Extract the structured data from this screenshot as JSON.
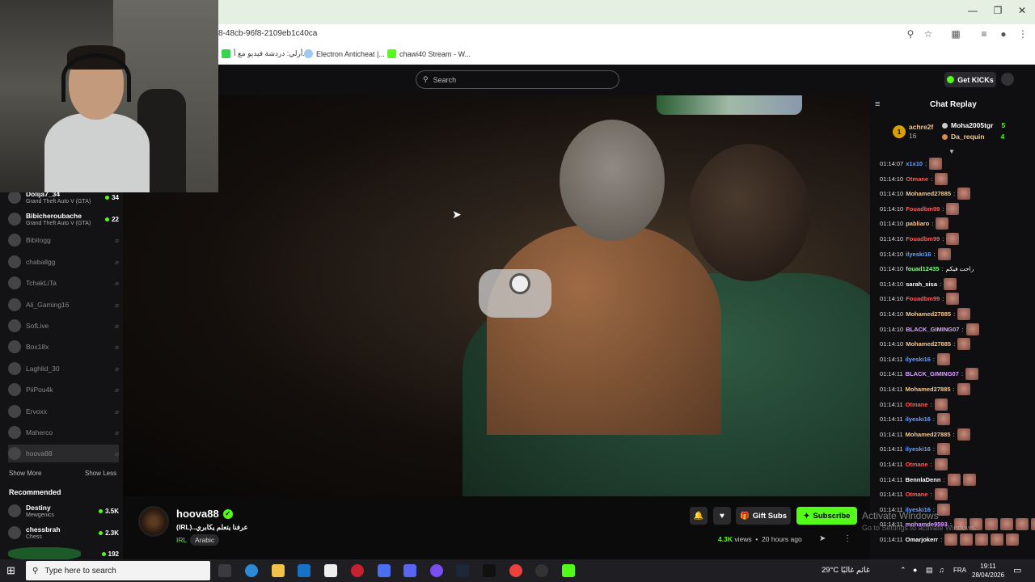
{
  "browser": {
    "url": "8-48cb-96f8-2109eb1c40ca",
    "bookmarks": [
      "أرلي: دردشة فيديو مع أ...",
      "Electron Anticheat |...",
      "chawi40 Stream - W..."
    ]
  },
  "topnav": {
    "search_placeholder": "Search",
    "get_kicks": "Get KICKs"
  },
  "sidebar": {
    "following": [
      {
        "name": "Dolija7_34",
        "game": "Grand Theft Auto V (GTA)",
        "viewers": "34",
        "live": true
      },
      {
        "name": "Bibicheroubache",
        "game": "Grand Theft Auto V (GTA)",
        "viewers": "22",
        "live": true
      },
      {
        "name": "Bibitogg",
        "live": false
      },
      {
        "name": "chaballgg",
        "live": false
      },
      {
        "name": "TchakLiTa",
        "live": false
      },
      {
        "name": "Ali_Gaming16",
        "live": false
      },
      {
        "name": "SofLive",
        "live": false
      },
      {
        "name": "Box18x",
        "live": false
      },
      {
        "name": "Laghlid_30",
        "live": false
      },
      {
        "name": "PiiPou4k",
        "live": false
      },
      {
        "name": "Ervoxx",
        "live": false
      },
      {
        "name": "Maherco",
        "live": false
      },
      {
        "name": "hoova88",
        "live": false
      }
    ],
    "show_more": "Show More",
    "show_less": "Show Less",
    "recommended_label": "Recommended",
    "recommended": [
      {
        "name": "Destiny",
        "game": "Mewgenics",
        "viewers": "3.5K"
      },
      {
        "name": "chessbrah",
        "game": "Chess",
        "viewers": "2.3K"
      },
      {
        "name": "",
        "game": "",
        "viewers": "192"
      }
    ]
  },
  "stream": {
    "streamer": "hoova88",
    "title": "(IRL)..عرفنا يتعلم يكابري",
    "category": "IRL",
    "tag": "Arabic",
    "gift_subs": "Gift Subs",
    "subscribe": "Subscribe",
    "views_count": "4.3K",
    "views_label": "views",
    "time_ago": "20 hours ago"
  },
  "chat": {
    "title": "Chat Replay",
    "gifters": [
      {
        "name": "achre2f",
        "count": "16",
        "rank": "1"
      },
      {
        "name": "Moha2005tgr",
        "count": "5"
      },
      {
        "name": "Da_requin",
        "count": "4"
      }
    ],
    "messages": [
      {
        "ts": "01:14:07",
        "user": "x1x10",
        "color": "#6aa0ff",
        "text": "",
        "emotes": 1
      },
      {
        "ts": "01:14:10",
        "user": "Otmane",
        "color": "#ff5a5a",
        "text": "",
        "emotes": 1
      },
      {
        "ts": "01:14:10",
        "user": "Mohamed27885",
        "color": "#f5c890",
        "text": "",
        "emotes": 1
      },
      {
        "ts": "01:14:10",
        "user": "Fouadbm99",
        "color": "#ff5a5a",
        "text": "",
        "emotes": 1
      },
      {
        "ts": "01:14:10",
        "user": "pabliaro",
        "color": "#f5c890",
        "text": "",
        "emotes": 1
      },
      {
        "ts": "01:14:10",
        "user": "Fouadbm99",
        "color": "#ff5a5a",
        "text": "",
        "emotes": 1
      },
      {
        "ts": "01:14:10",
        "user": "ilyeski16",
        "color": "#6aa0ff",
        "text": "",
        "emotes": 1
      },
      {
        "ts": "01:14:10",
        "user": "fouad12435",
        "color": "#7dff7d",
        "text": "راحت فيكم",
        "emotes": 0
      },
      {
        "ts": "01:14:10",
        "user": "sarah_sisa",
        "color": "#ffffff",
        "text": "",
        "emotes": 1
      },
      {
        "ts": "01:14:10",
        "user": "Fouadbm99",
        "color": "#ff5a5a",
        "text": "",
        "emotes": 1
      },
      {
        "ts": "01:14:10",
        "user": "Mohamed27885",
        "color": "#f5c890",
        "text": "",
        "emotes": 1
      },
      {
        "ts": "01:14:10",
        "user": "BLACK_GIMING07",
        "color": "#d9a0ff",
        "text": "",
        "emotes": 1
      },
      {
        "ts": "01:14:10",
        "user": "Mohamed27885",
        "color": "#f5c890",
        "text": "",
        "emotes": 1
      },
      {
        "ts": "01:14:11",
        "user": "ilyeski16",
        "color": "#6aa0ff",
        "text": "",
        "emotes": 1
      },
      {
        "ts": "01:14:11",
        "user": "BLACK_GIMING07",
        "color": "#d9a0ff",
        "text": "",
        "emotes": 1
      },
      {
        "ts": "01:14:11",
        "user": "Mohamed27885",
        "color": "#f5c890",
        "text": "",
        "emotes": 1
      },
      {
        "ts": "01:14:11",
        "user": "Otmane",
        "color": "#ff5a5a",
        "text": "",
        "emotes": 1
      },
      {
        "ts": "01:14:11",
        "user": "ilyeski16",
        "color": "#6aa0ff",
        "text": "",
        "emotes": 1
      },
      {
        "ts": "01:14:11",
        "user": "Mohamed27885",
        "color": "#f5c890",
        "text": "",
        "emotes": 1
      },
      {
        "ts": "01:14:11",
        "user": "ilyeski16",
        "color": "#6aa0ff",
        "text": "",
        "emotes": 1
      },
      {
        "ts": "01:14:11",
        "user": "Otmane",
        "color": "#ff5a5a",
        "text": "",
        "emotes": 1
      },
      {
        "ts": "01:14:11",
        "user": "BennlaDenn",
        "color": "#ffffff",
        "text": "",
        "emotes": 2
      },
      {
        "ts": "01:14:11",
        "user": "Otmane",
        "color": "#ff5a5a",
        "text": "",
        "emotes": 1
      },
      {
        "ts": "01:14:11",
        "user": "ilyeski16",
        "color": "#6aa0ff",
        "text": "",
        "emotes": 1
      },
      {
        "ts": "01:14:11",
        "user": "mohamde9593",
        "color": "#d9a0ff",
        "text": "",
        "emotes": 6
      },
      {
        "ts": "01:14:11",
        "user": "Omarjokerr",
        "color": "#ffffff",
        "text": "",
        "emotes": 5
      }
    ]
  },
  "overlay": {
    "activate": "Activate Windows",
    "activate_sub": "Go to Settings to activate Windows."
  },
  "taskbar": {
    "search_placeholder": "Type here to search",
    "weather": "29°C",
    "weather_text": "غائم غالبًا",
    "lang": "FRA",
    "time": "19:11",
    "date": "28/04/2026"
  },
  "colors": {
    "accent": "#53fc18",
    "bg": "#0b0b0c",
    "panel": "#131315"
  }
}
